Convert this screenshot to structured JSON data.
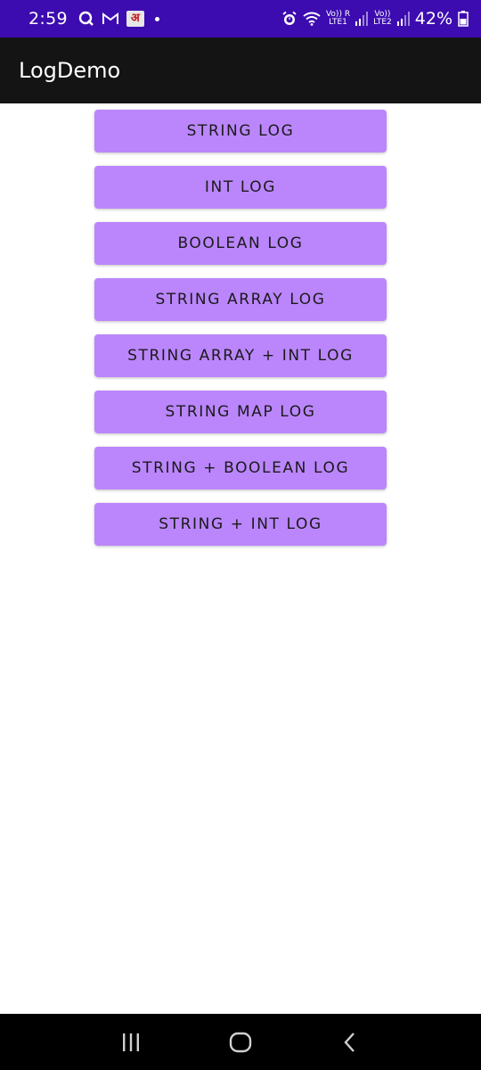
{
  "status_bar": {
    "time": "2:59",
    "notification_icons": [
      "q-app-icon",
      "gmail-icon",
      "amar-ujala-icon"
    ],
    "amar_ujala_glyph": "अ",
    "net_sim1_top": "Vo)) R",
    "net_sim1_bottom": "LTE1",
    "net_sim2_top": "Vo))",
    "net_sim2_bottom": "LTE2",
    "battery_percent": "42%"
  },
  "app_bar": {
    "title": "LogDemo"
  },
  "buttons": [
    {
      "label": "STRING LOG"
    },
    {
      "label": "INT LOG"
    },
    {
      "label": "BOOLEAN LOG"
    },
    {
      "label": "STRING ARRAY LOG"
    },
    {
      "label": "STRING ARRAY + INT LOG"
    },
    {
      "label": "STRING MAP LOG"
    },
    {
      "label": "STRING + BOOLEAN LOG"
    },
    {
      "label": "STRING + INT LOG"
    }
  ],
  "colors": {
    "status_bar": "#3d0cb0",
    "app_bar": "#141414",
    "button": "#bb86fc",
    "nav_bar": "#000000"
  },
  "nav_bar": {
    "icons": [
      "recent-apps-icon",
      "home-icon",
      "back-icon"
    ]
  }
}
